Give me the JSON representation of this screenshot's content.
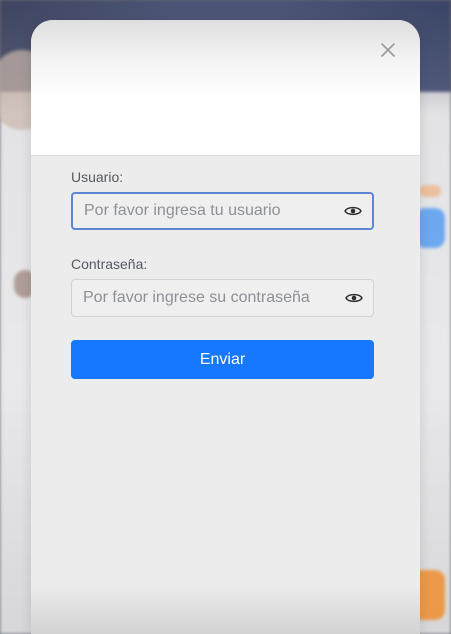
{
  "modal": {
    "close_icon": "close-icon"
  },
  "form": {
    "username_label": "Usuario:",
    "username_placeholder": "Por favor ingresa tu usuario",
    "username_value": "",
    "password_label": "Contraseña:",
    "password_placeholder": "Por favor ingrese su contraseña",
    "password_value": "",
    "eye_icon": "eye-icon",
    "submit_label": "Enviar"
  },
  "colors": {
    "primary": "#1677ff",
    "focus_border": "#5b87d6"
  }
}
